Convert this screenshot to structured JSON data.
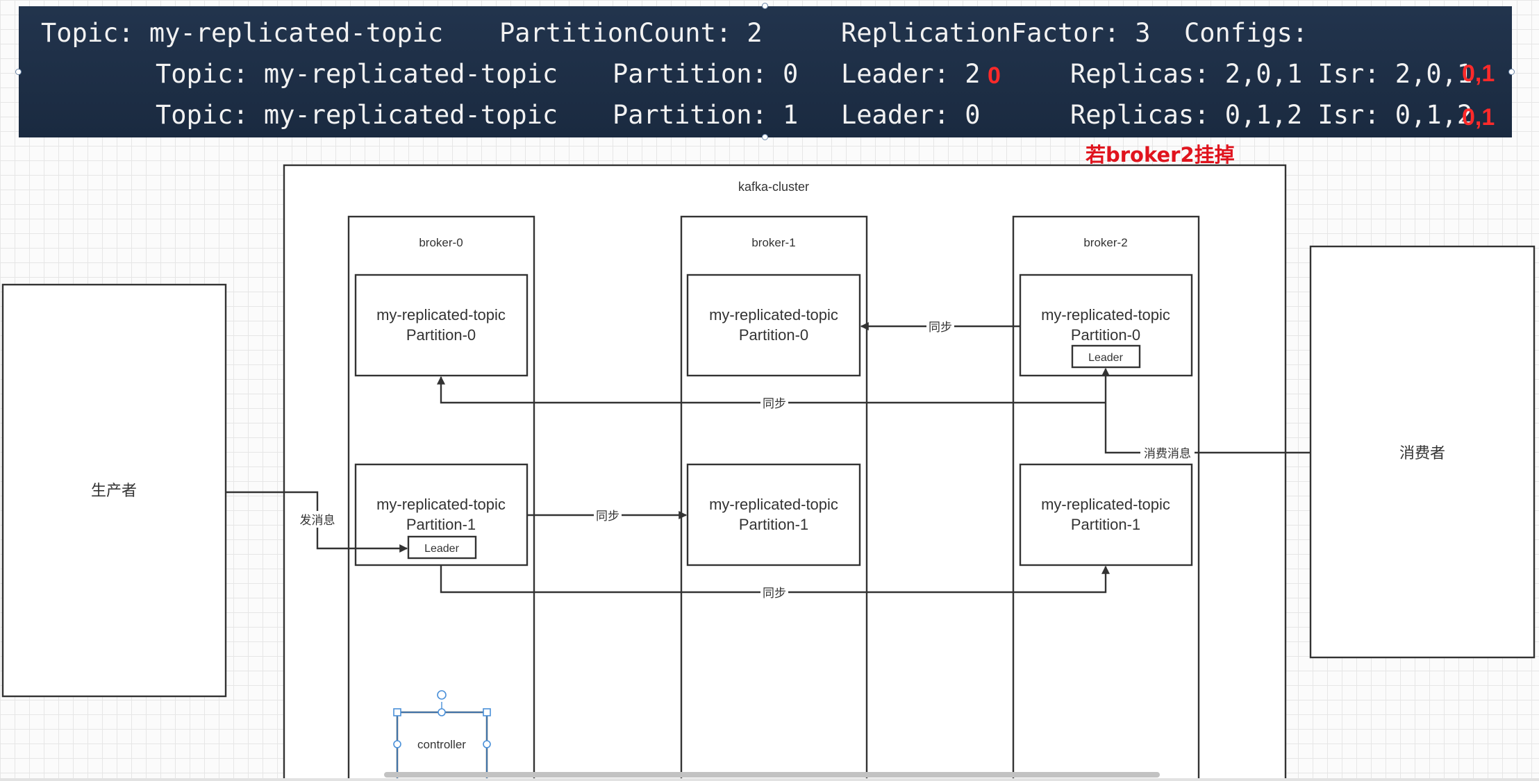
{
  "terminal": {
    "line1": {
      "topic": "Topic: my-replicated-topic",
      "partition_count": "PartitionCount: 2",
      "replication_factor": "ReplicationFactor: 3",
      "configs": "Configs:"
    },
    "line2": {
      "topic": "Topic: my-replicated-topic",
      "partition": "Partition: 0",
      "leader": "Leader: 2",
      "leader_annotation": "0",
      "replicas": "Replicas: 2,0,1 Isr: 2,0,1",
      "isr_annotation": "0,1"
    },
    "line3": {
      "topic": "Topic: my-replicated-topic",
      "partition": "Partition: 1",
      "leader": "Leader: 0",
      "replicas": "Replicas: 0,1,2 Isr: 0,1,2",
      "isr_annotation": "0,1"
    }
  },
  "annotation_note": "若broker2挂掉",
  "diagram": {
    "cluster_label": "kafka-cluster",
    "producer_label": "生产者",
    "consumer_label": "消费者",
    "brokers": [
      {
        "label": "broker-0",
        "partitions": [
          {
            "topic": "my-replicated-topic",
            "partition": "Partition-0"
          },
          {
            "topic": "my-replicated-topic",
            "partition": "Partition-1",
            "badge": "Leader"
          }
        ]
      },
      {
        "label": "broker-1",
        "partitions": [
          {
            "topic": "my-replicated-topic",
            "partition": "Partition-0"
          },
          {
            "topic": "my-replicated-topic",
            "partition": "Partition-1"
          }
        ]
      },
      {
        "label": "broker-2",
        "partitions": [
          {
            "topic": "my-replicated-topic",
            "partition": "Partition-0",
            "badge": "Leader"
          },
          {
            "topic": "my-replicated-topic",
            "partition": "Partition-1"
          }
        ]
      }
    ],
    "edge_labels": {
      "sync_b2_b1_p0": "同步",
      "sync_b2_b0_p0": "同步",
      "consume": "消费消息",
      "send": "发消息",
      "sync_b0_b1_p1": "同步",
      "sync_b0_b2_p1": "同步"
    },
    "controller_label": "controller"
  },
  "colors": {
    "terminal_bg": "#1e3048",
    "terminal_text": "#f2f2f2",
    "annotation_red": "#ff2a2a",
    "line": "#333333"
  }
}
